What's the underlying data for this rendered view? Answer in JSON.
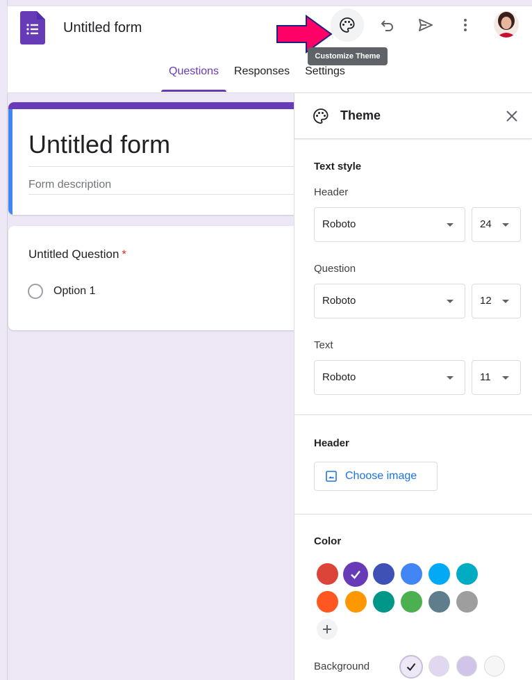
{
  "header": {
    "doc_title": "Untitled form",
    "tooltip": "Customize Theme",
    "tabs": [
      "Questions",
      "Responses",
      "Settings"
    ],
    "active_tab": "Questions"
  },
  "form": {
    "title": "Untitled form",
    "description_placeholder": "Form description",
    "question": {
      "title": "Untitled Question",
      "required_mark": "*",
      "options": [
        "Option 1"
      ]
    }
  },
  "theme_panel": {
    "title": "Theme",
    "text_style": {
      "label": "Text style",
      "header": {
        "label": "Header",
        "font": "Roboto",
        "size": "24"
      },
      "question": {
        "label": "Question",
        "font": "Roboto",
        "size": "12"
      },
      "text": {
        "label": "Text",
        "font": "Roboto",
        "size": "11"
      }
    },
    "header_section": {
      "label": "Header",
      "choose_image": "Choose image"
    },
    "color_section": {
      "label": "Color",
      "swatches": [
        "#db4437",
        "#673ab7",
        "#3f51b5",
        "#4285f4",
        "#03a9f4",
        "#00acc1",
        "#ff5722",
        "#ff9800",
        "#009688",
        "#4caf50",
        "#607d8b",
        "#9e9e9e"
      ],
      "selected_swatch": "#673ab7",
      "background_label": "Background",
      "background_swatches": [
        "#ede7f6",
        "#e1d7f1",
        "#d1c4e9",
        "#f6f6f6"
      ],
      "selected_background": "#ede7f6"
    }
  },
  "colors": {
    "accent": "#673ab7",
    "arrow": "#e91e63"
  }
}
